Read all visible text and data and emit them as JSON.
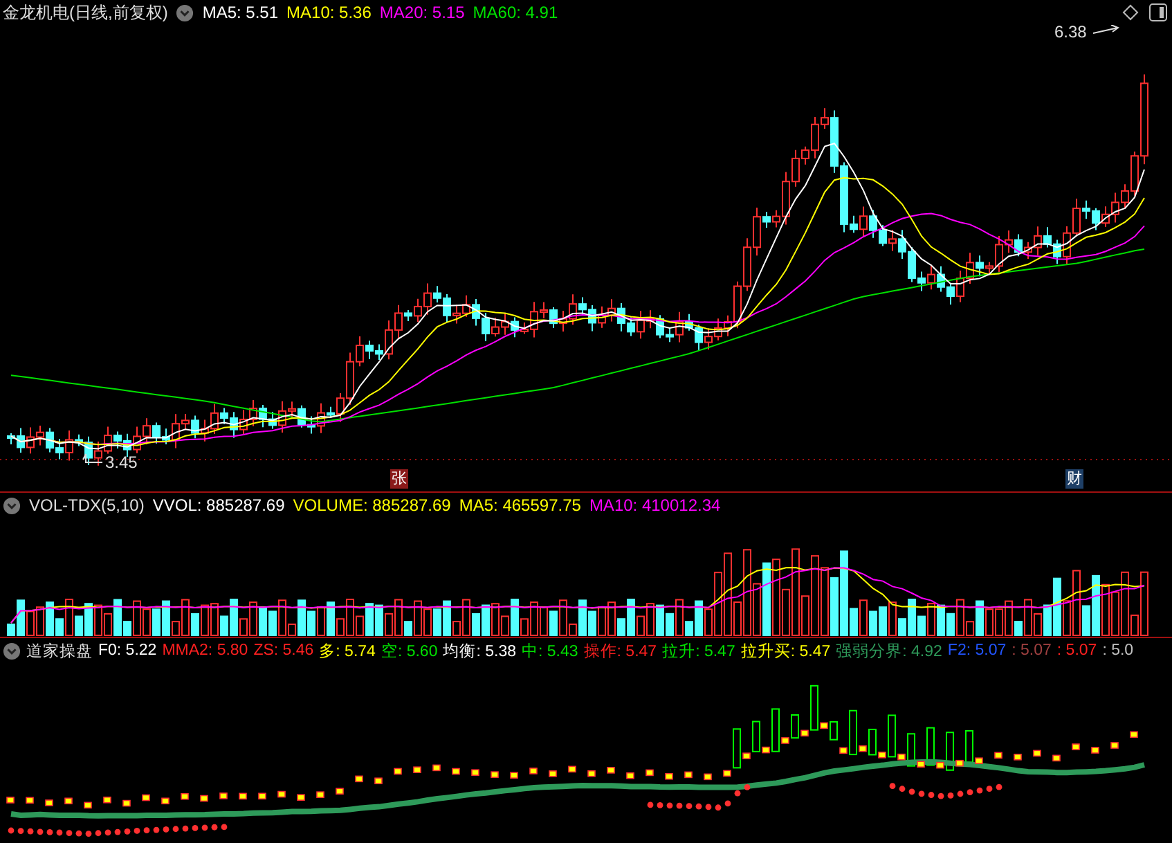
{
  "main_panel": {
    "title": "金龙机电(日线,前复权)",
    "indicators": [
      {
        "text": "MA5: 5.51",
        "color": "#ffffff"
      },
      {
        "text": "MA10: 5.36",
        "color": "#ffff00"
      },
      {
        "text": "MA20: 5.15",
        "color": "#ff00ff"
      },
      {
        "text": "MA60: 4.91",
        "color": "#00e000"
      }
    ],
    "high_label": "6.38",
    "low_label": "3.45",
    "markers": [
      {
        "text": "张",
        "color": "#8b1a1a"
      },
      {
        "text": "财",
        "color": "#1e3f66"
      }
    ]
  },
  "volume_panel": {
    "title": "VOL-TDX(5,10)",
    "indicators": [
      {
        "text": "VVOL: 885287.69",
        "color": "#ffffff"
      },
      {
        "text": "VOLUME: 885287.69",
        "color": "#ffff00"
      },
      {
        "text": "MA5: 465597.75",
        "color": "#ffff00"
      },
      {
        "text": "MA10: 410012.34",
        "color": "#ff00ff"
      }
    ]
  },
  "indicator_panel": {
    "title": "道家操盘",
    "indicators": [
      {
        "text": "F0: 5.22",
        "color": "#ffffff"
      },
      {
        "text": "MMA2: 5.80",
        "color": "#ff2020"
      },
      {
        "text": "ZS: 5.46",
        "color": "#ff2020"
      },
      {
        "text": "多: 5.74",
        "color": "#ffff00"
      },
      {
        "text": "空: 5.60",
        "color": "#00e000"
      },
      {
        "text": "均衡: 5.38",
        "color": "#ffffff"
      },
      {
        "text": "中: 5.43",
        "color": "#00e000"
      },
      {
        "text": "操作: 5.47",
        "color": "#ff2020"
      },
      {
        "text": "拉升: 5.47",
        "color": "#00e000"
      },
      {
        "text": "拉升买: 5.47",
        "color": "#ffff00"
      },
      {
        "text": "强弱分界: 4.92",
        "color": "#2e9a5a"
      },
      {
        "text": "F2: 5.07",
        "color": "#2255ff"
      },
      {
        "text": ": 5.07",
        "color": "#a04040"
      },
      {
        "text": ": 5.07",
        "color": "#ff2020"
      },
      {
        "text": ": 5.0",
        "color": "#c0c0c0"
      }
    ]
  }
}
